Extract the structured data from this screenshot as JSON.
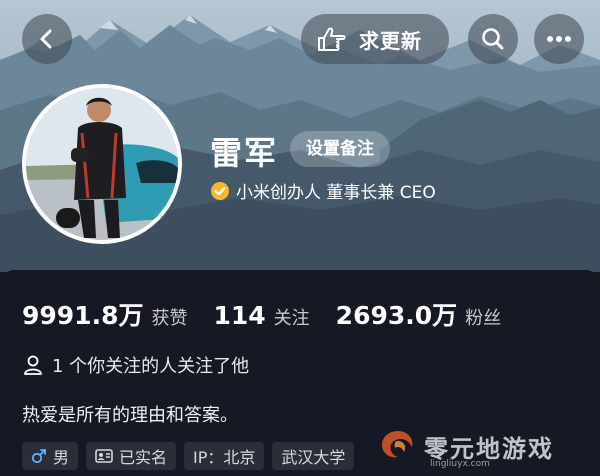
{
  "header": {
    "update_label": "求更新",
    "icons": [
      "back-icon",
      "thumbs-pointing-icon",
      "search-icon",
      "more-icon"
    ]
  },
  "profile": {
    "name": "雷军",
    "remark_label": "设置备注",
    "verified_title": "小米创办人 董事长兼 CEO",
    "stats": [
      {
        "value": "9991.8万",
        "label": "获赞"
      },
      {
        "value": "114",
        "label": "关注"
      },
      {
        "value": "2693.0万",
        "label": "粉丝"
      }
    ],
    "mutual_follow": "1 个你关注的人关注了他",
    "bio": "热爱是所有的理由和答案。",
    "tags": [
      {
        "icon": "male-icon",
        "label": "男"
      },
      {
        "icon": "id-card-icon",
        "label": "已实名"
      },
      {
        "icon": "",
        "label": "IP：北京"
      },
      {
        "icon": "",
        "label": "武汉大学"
      }
    ]
  },
  "watermark": {
    "text": "零元地游戏",
    "url": "lingliuyx.com"
  },
  "colors": {
    "background": "#161823",
    "verified_badge": "#f5b82e",
    "tag_bg": "#2b2d38"
  }
}
